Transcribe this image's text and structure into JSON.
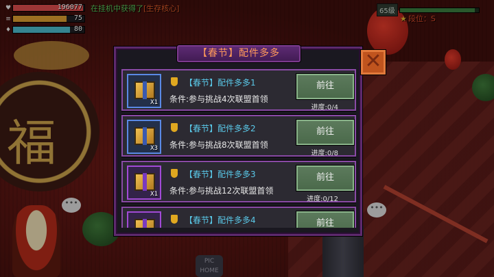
{
  "hud": {
    "hp": {
      "value": "196077",
      "fill": 0.98,
      "color": "#d84c4c"
    },
    "energy": {
      "value": "75",
      "fill": 0.75,
      "color": "#d89a30"
    },
    "mana": {
      "value": "80",
      "fill": 0.8,
      "color": "#4cb8c8"
    }
  },
  "notice": {
    "prefix": "在挂机中获得了",
    "item": "[生存核心]"
  },
  "level": {
    "label": "65级",
    "fill": 0.95
  },
  "rank": {
    "label": "段位：S"
  },
  "dialog": {
    "title": "【春节】配件多多",
    "close_symbol": "✕",
    "tasks": [
      {
        "title": "【春节】配件多多1",
        "condition": "条件:参与挑战4次联盟首领",
        "button": "前往",
        "progress": "进度:0/4",
        "qty": "X1",
        "frame": "blue"
      },
      {
        "title": "【春节】配件多多2",
        "condition": "条件:参与挑战8次联盟首领",
        "button": "前往",
        "progress": "进度:0/8",
        "qty": "X3",
        "frame": "blue"
      },
      {
        "title": "【春节】配件多多3",
        "condition": "条件:参与挑战12次联盟首领",
        "button": "前往",
        "progress": "进度:0/12",
        "qty": "X1",
        "frame": "purple"
      },
      {
        "title": "【春节】配件多多4",
        "condition": "",
        "button": "前往",
        "progress": "",
        "qty": "",
        "frame": "purple"
      }
    ]
  },
  "scene": {
    "fu_char": "福",
    "chat_symbol": "•••",
    "bottom_label": "PIC\nHOME"
  }
}
